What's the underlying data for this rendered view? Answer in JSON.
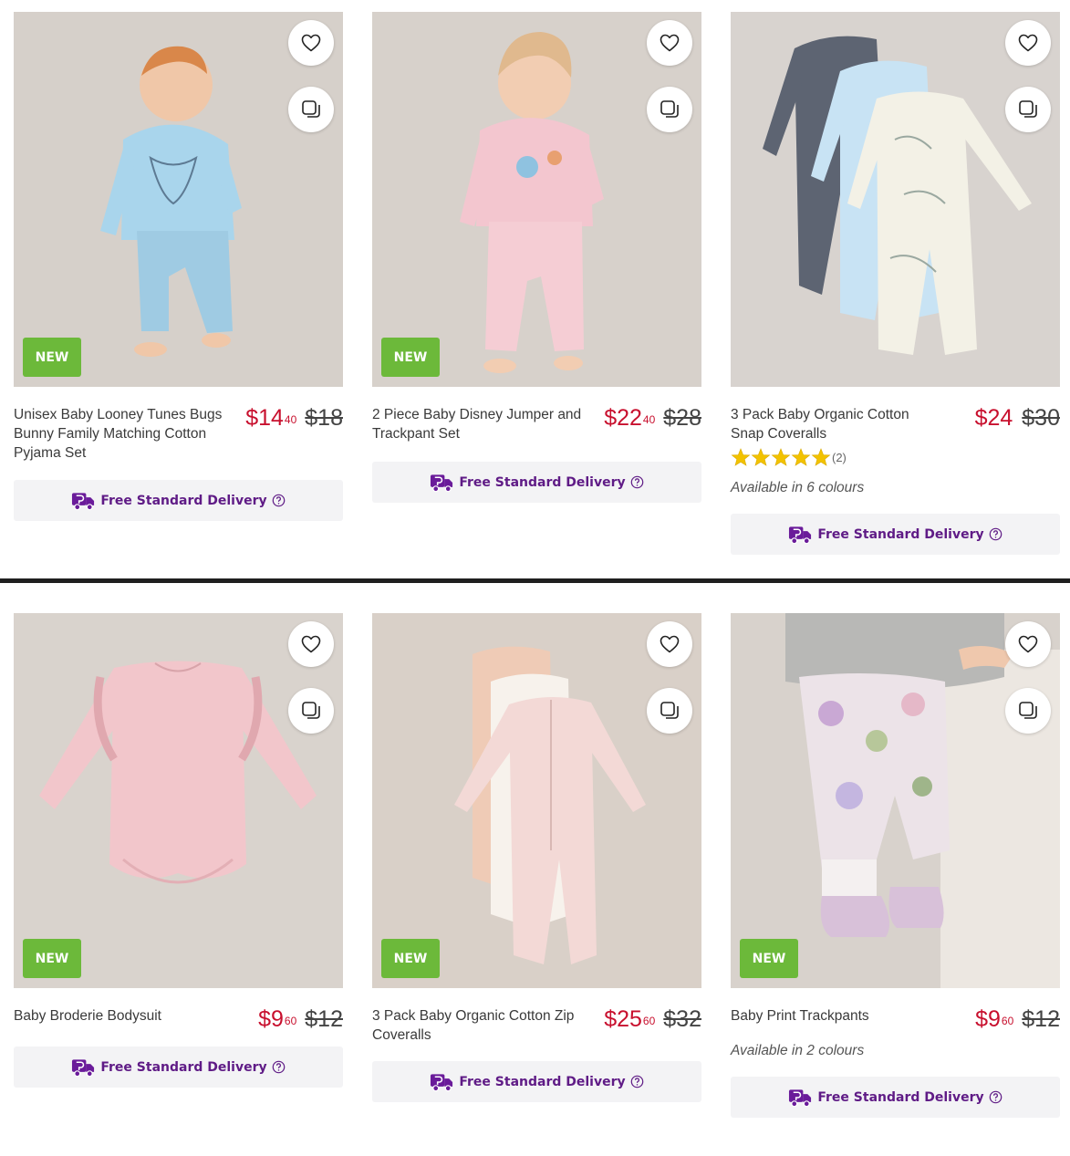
{
  "delivery_label": "Free Standard Delivery",
  "new_label": "NEW",
  "colors": {
    "price": "#c8102e",
    "badge": "#6cb93a",
    "delivery_text": "#5f1b86",
    "delivery_bg": "#f3f3f5"
  },
  "icons": {
    "wishlist": "heart-icon",
    "quick_view": "quick-view-icon",
    "delivery": "delivery-truck-icon",
    "help": "help-circle-icon",
    "rating": "star-icon"
  },
  "products": [
    {
      "title": "Unisex Baby Looney Tunes Bugs Bunny Family Matching Cotton Pyjama Set",
      "price_dollars": "$14",
      "price_cents": "40",
      "was_price": "$18",
      "is_new": true
    },
    {
      "title": "2 Piece Baby Disney Jumper and Trackpant Set",
      "price_dollars": "$22",
      "price_cents": "40",
      "was_price": "$28",
      "is_new": true
    },
    {
      "title": "3 Pack Baby Organic Cotton Snap Coveralls",
      "price_dollars": "$24",
      "price_cents": "",
      "was_price": "$30",
      "rating_stars": 5,
      "rating_count": "(2)",
      "availability": "Available in 6 colours",
      "is_new": false
    },
    {
      "title": "Baby Broderie Bodysuit",
      "price_dollars": "$9",
      "price_cents": "60",
      "was_price": "$12",
      "is_new": true
    },
    {
      "title": "3 Pack Baby Organic Cotton Zip Coveralls",
      "price_dollars": "$25",
      "price_cents": "60",
      "was_price": "$32",
      "is_new": true
    },
    {
      "title": "Baby Print Trackpants",
      "price_dollars": "$9",
      "price_cents": "60",
      "was_price": "$12",
      "availability": "Available in 2 colours",
      "is_new": true
    }
  ]
}
